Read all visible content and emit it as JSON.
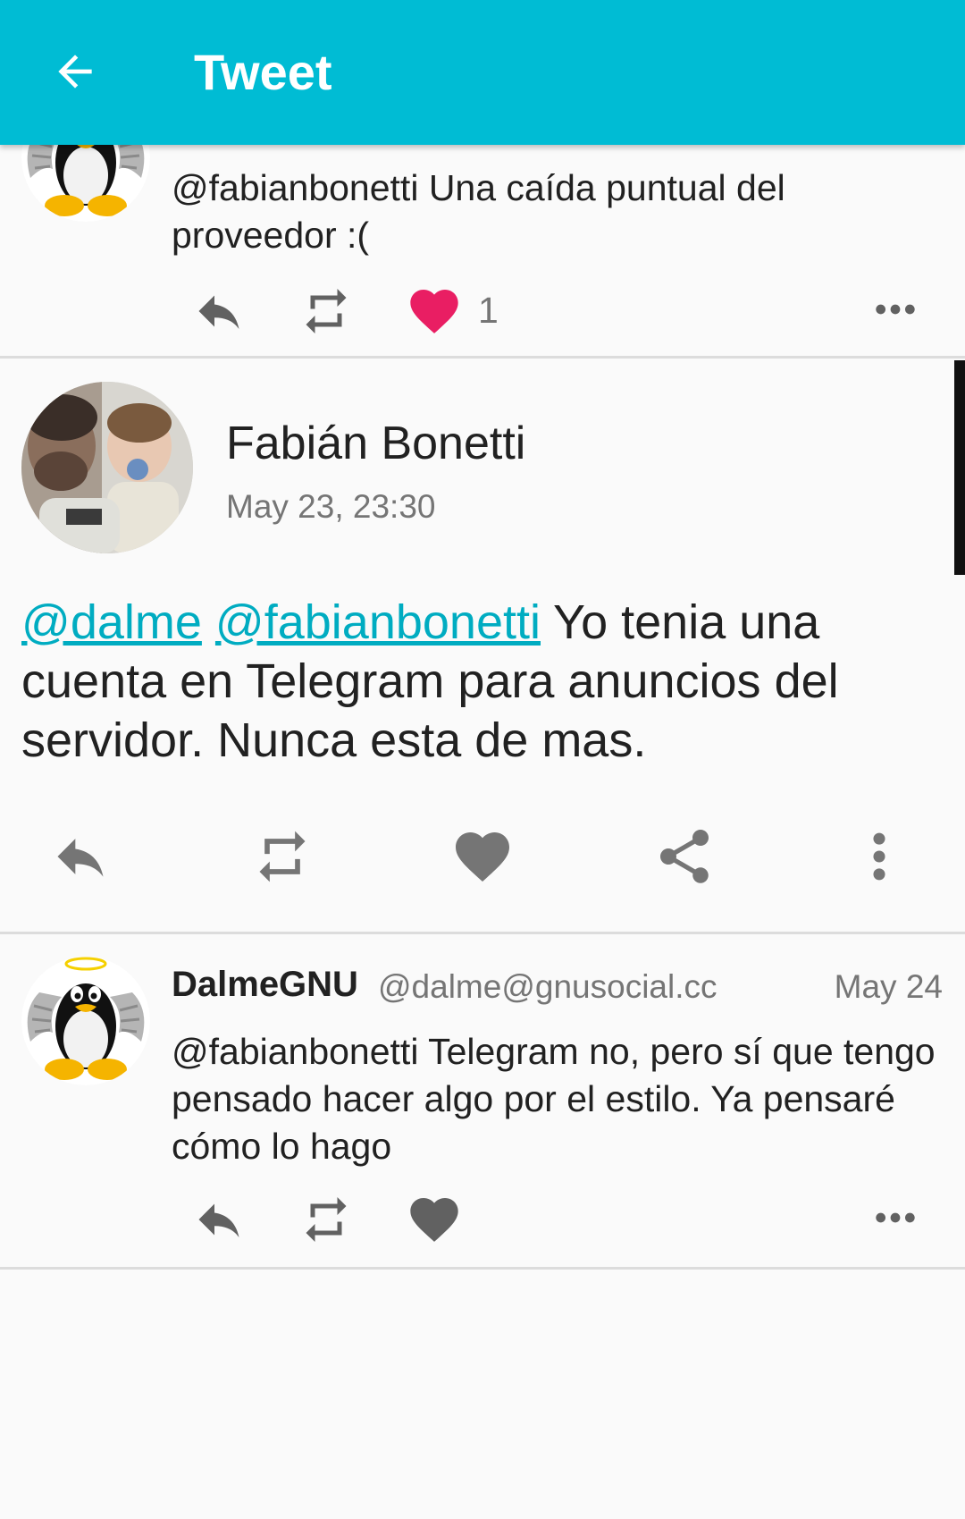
{
  "appbar": {
    "title": "Tweet",
    "background": "#00bcd4"
  },
  "previous_reply": {
    "text": "@fabianbonetti Una caída puntual del proveedor :(",
    "like_count": "1",
    "liked_color": "#e91e63"
  },
  "main_tweet": {
    "author_name": "Fabián Bonetti",
    "date": "May 23, 23:30",
    "mention_1": "@dalme",
    "mention_2": "@fabianbonetti",
    "body": " Yo tenia una cuenta en Telegram para anuncios del servidor. Nunca esta de mas.",
    "actions": [
      "reply-icon",
      "retweet-icon",
      "like-icon",
      "share-icon",
      "more-vert-icon"
    ]
  },
  "next_reply": {
    "author_name": "DalmeGNU",
    "author_handle": "@dalme@gnusocial.cc",
    "date": "May 24",
    "text": "@fabianbonetti Telegram no, pero sí que tengo pensado hacer algo por el estilo. Ya pensaré cómo lo hago"
  },
  "colors": {
    "accent": "#00bcd4",
    "mention": "#00acc1",
    "like": "#e91e63",
    "icon": "#757575"
  }
}
